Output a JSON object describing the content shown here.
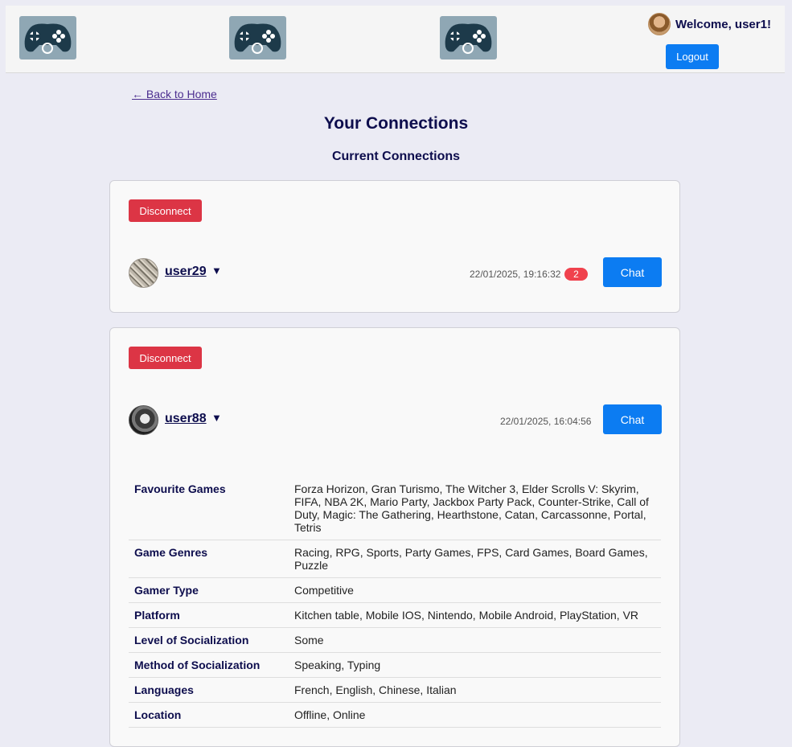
{
  "header": {
    "logos": [
      "gamepad-logo",
      "gamepad-logo",
      "gamepad-logo"
    ],
    "welcome_text": "Welcome, user1!",
    "logout_label": "Logout"
  },
  "back_link": "← Back to Home",
  "page_title": "Your Connections",
  "section_title": "Current Connections",
  "connections": [
    {
      "disconnect_label": "Disconnect",
      "username": "user29",
      "caret": "▼",
      "timestamp": "22/01/2025, 19:16:32",
      "unread_count": "2",
      "chat_label": "Chat"
    },
    {
      "disconnect_label": "Disconnect",
      "username": "user88",
      "caret": "▼",
      "timestamp": "22/01/2025, 16:04:56",
      "chat_label": "Chat",
      "details": [
        {
          "key": "Favourite Games",
          "value": "Forza Horizon, Gran Turismo, The Witcher 3, Elder Scrolls V: Skyrim, FIFA, NBA 2K, Mario Party, Jackbox Party Pack, Counter-Strike, Call of Duty, Magic: The Gathering, Hearthstone, Catan, Carcassonne, Portal, Tetris"
        },
        {
          "key": "Game Genres",
          "value": "Racing, RPG, Sports, Party Games, FPS, Card Games, Board Games, Puzzle"
        },
        {
          "key": "Gamer Type",
          "value": "Competitive"
        },
        {
          "key": "Platform",
          "value": "Kitchen table, Mobile IOS, Nintendo, Mobile Android, PlayStation, VR"
        },
        {
          "key": "Level of Socialization",
          "value": "Some"
        },
        {
          "key": "Method of Socialization",
          "value": "Speaking, Typing"
        },
        {
          "key": "Languages",
          "value": "French, English, Chinese, Italian"
        },
        {
          "key": "Location",
          "value": "Offline, Online"
        }
      ]
    }
  ],
  "colors": {
    "primary": "#0c7cf2",
    "danger": "#dc3545",
    "badge": "#f0424d",
    "heading": "#0d0d4d",
    "background": "#ebebf4"
  }
}
